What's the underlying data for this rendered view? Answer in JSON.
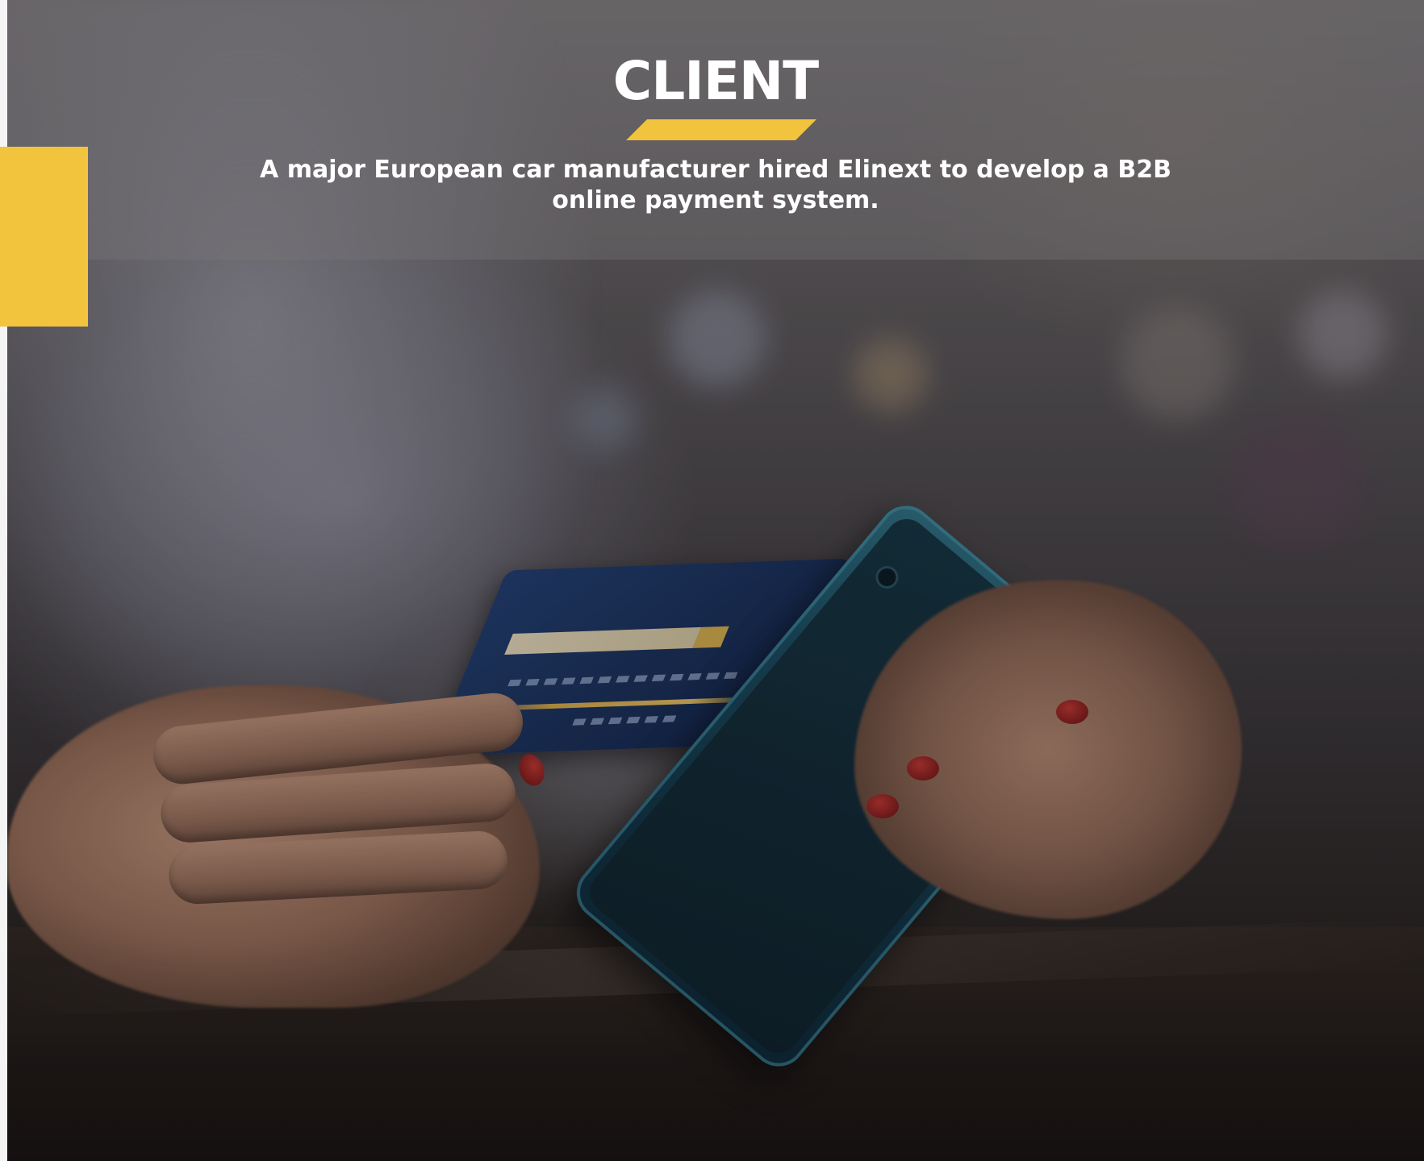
{
  "section": {
    "title": "CLIENT",
    "description_line1": "A major European car manufacturer hired Elinext to develop a B2B",
    "description_line2": "online payment system."
  },
  "colors": {
    "accent": "#f2c33c",
    "title_text": "#ffffff"
  },
  "image": {
    "subject": "hands holding a credit card and a smartphone"
  }
}
